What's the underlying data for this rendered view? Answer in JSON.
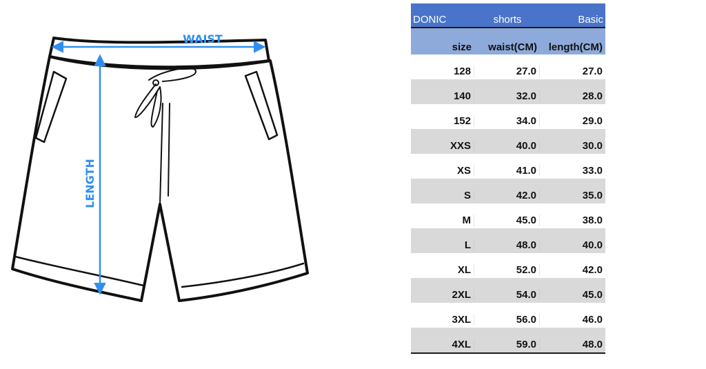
{
  "illustration": {
    "waist_label": "WAIST",
    "length_label": "LENGTH",
    "arrow_color": "#2f8ff0"
  },
  "size_chart": {
    "brand": "DONIC",
    "product": "shorts",
    "line": "Basic",
    "headers": [
      "size",
      "waist(CM)",
      "length(CM)"
    ],
    "rows": [
      {
        "size": "128",
        "waist": "27.0",
        "length": "27.0"
      },
      {
        "size": "140",
        "waist": "32.0",
        "length": "28.0"
      },
      {
        "size": "152",
        "waist": "34.0",
        "length": "29.0"
      },
      {
        "size": "XXS",
        "waist": "40.0",
        "length": "30.0"
      },
      {
        "size": "XS",
        "waist": "41.0",
        "length": "33.0"
      },
      {
        "size": "S",
        "waist": "42.0",
        "length": "35.0"
      },
      {
        "size": "M",
        "waist": "45.0",
        "length": "38.0"
      },
      {
        "size": "L",
        "waist": "48.0",
        "length": "40.0"
      },
      {
        "size": "XL",
        "waist": "52.0",
        "length": "42.0"
      },
      {
        "size": "2XL",
        "waist": "54.0",
        "length": "45.0"
      },
      {
        "size": "3XL",
        "waist": "56.0",
        "length": "46.0"
      },
      {
        "size": "4XL",
        "waist": "59.0",
        "length": "48.0"
      }
    ],
    "colors": {
      "brand_row": "#4a74c9",
      "header_row": "#8eaadb",
      "stripe": "#d9d9d9"
    }
  }
}
